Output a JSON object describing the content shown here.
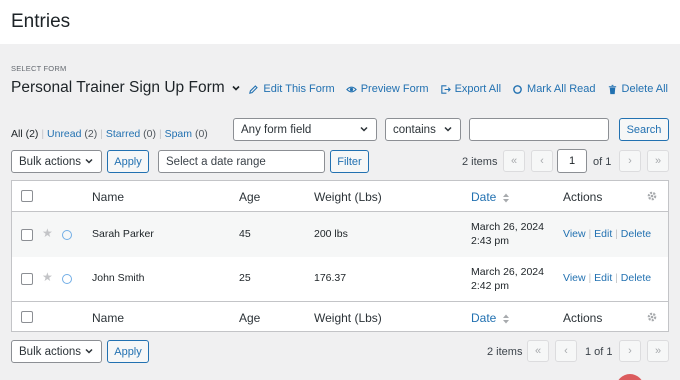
{
  "page": {
    "title": "Entries"
  },
  "form_selector": {
    "label": "SELECT FORM",
    "name": "Personal Trainer Sign Up Form"
  },
  "form_actions": [
    {
      "label": "Edit This Form",
      "icon": "pencil-icon"
    },
    {
      "label": "Preview Form",
      "icon": "eye-icon"
    },
    {
      "label": "Export All",
      "icon": "export-icon"
    },
    {
      "label": "Mark All Read",
      "icon": "circle-icon"
    },
    {
      "label": "Delete All",
      "icon": "trash-icon"
    }
  ],
  "status_links": {
    "all": {
      "label": "All",
      "count": "(2)"
    },
    "unread": {
      "label": "Unread",
      "count": "(2)"
    },
    "starred": {
      "label": "Starred",
      "count": "(0)"
    },
    "spam": {
      "label": "Spam",
      "count": "(0)"
    }
  },
  "search": {
    "field_select": "Any form field",
    "operator_select": "contains",
    "query": "",
    "button": "Search"
  },
  "top_controls": {
    "bulk_actions": "Bulk actions",
    "apply": "Apply",
    "date_placeholder": "Select a date range",
    "filter": "Filter",
    "items": "2 items",
    "page": "1",
    "of_pages": "of 1"
  },
  "table": {
    "columns": {
      "name": "Name",
      "age": "Age",
      "weight": "Weight (Lbs)",
      "date": "Date",
      "actions": "Actions"
    },
    "rows": [
      {
        "name": "Sarah Parker",
        "age": "45",
        "weight": "200 lbs",
        "date_line1": "March 26, 2024",
        "date_line2": "2:43 pm",
        "view": "View",
        "edit": "Edit",
        "delete": "Delete"
      },
      {
        "name": "John Smith",
        "age": "25",
        "weight": "176.37",
        "date_line1": "March 26, 2024",
        "date_line2": "2:42 pm",
        "view": "View",
        "edit": "Edit",
        "delete": "Delete"
      }
    ]
  },
  "bottom_controls": {
    "bulk_actions": "Bulk actions",
    "apply": "Apply",
    "items": "2 items",
    "page_text": "1 of 1"
  },
  "colors": {
    "accent": "#2271b1",
    "background": "#f0f0f1",
    "border": "#c3c4c7"
  }
}
